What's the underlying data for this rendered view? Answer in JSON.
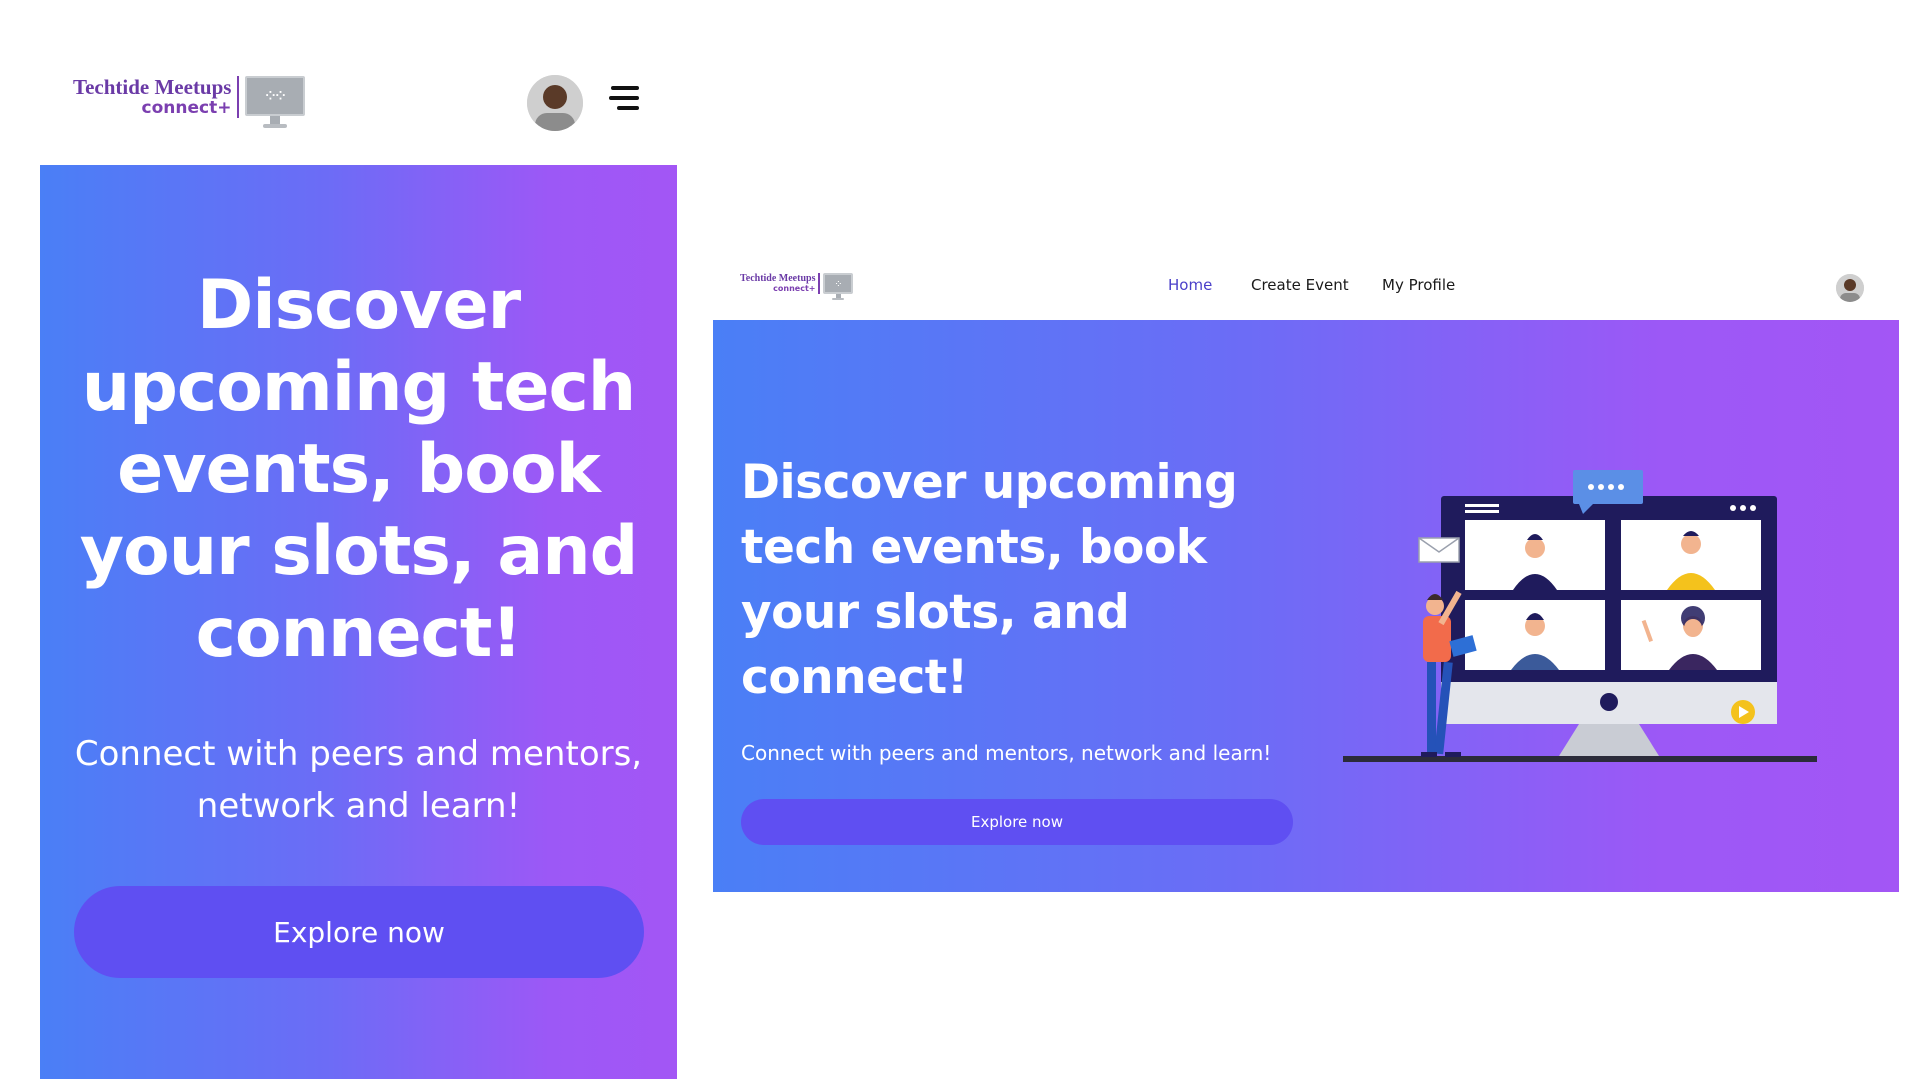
{
  "brand": {
    "title": "Techtide Meetups",
    "subtitle": "connect+"
  },
  "mobile": {
    "hero": {
      "heading": "Discover upcoming tech events, book your slots, and connect!",
      "subheading": "Connect with peers and mentors, network and learn!",
      "button_label": "Explore now"
    },
    "icons": {
      "menu": "hamburger-menu-icon",
      "avatar": "user-avatar"
    }
  },
  "desktop": {
    "nav": {
      "items": [
        {
          "label": "Home",
          "active": true
        },
        {
          "label": "Create Event",
          "active": false
        },
        {
          "label": "My Profile",
          "active": false
        }
      ]
    },
    "hero": {
      "heading": "Discover upcoming tech events, book your slots, and connect!",
      "subheading": "Connect with peers and mentors, network and learn!",
      "button_label": "Explore now"
    }
  },
  "colors": {
    "gradient_start": "#4a7ff6",
    "gradient_end": "#a356f5",
    "button": "#5f4ff2",
    "brand_purple": "#6a3aa6",
    "nav_active": "#4a3fc9"
  }
}
